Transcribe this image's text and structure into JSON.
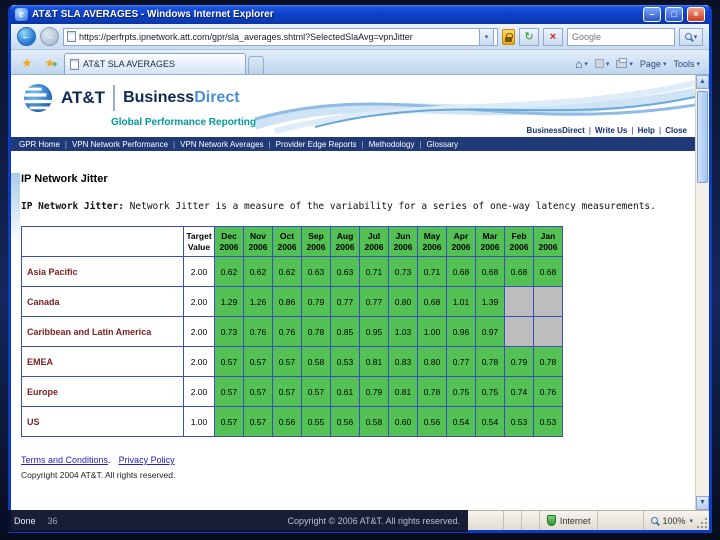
{
  "slide": {
    "page_number": "36",
    "footer_copyright": "Copyright © 2006 AT&T. All rights reserved."
  },
  "browser": {
    "title": "AT&T SLA AVERAGES - Windows Internet Explorer",
    "url": "https://perfrpts.ipnetwork.att.com/gpr/sla_averages.shtml?SelectedSlaAvg=vpnJitter",
    "search_placeholder": "Google",
    "tab": "AT&T SLA AVERAGES",
    "page_menu": "Page",
    "tools_menu": "Tools",
    "status": "Done",
    "zone": "Internet",
    "zoom": "100%"
  },
  "page": {
    "brand_att": "AT&T",
    "brand_business": "Business",
    "brand_direct": "Direct",
    "brand_subtitle": "Global Performance Reporting",
    "top_links": [
      "BusinessDirect",
      "Write Us",
      "Help",
      "Close"
    ],
    "nav_items": [
      "GPR Home",
      "VPN Network Performance",
      "VPN Network Averages",
      "Provider Edge Reports",
      "Methodology",
      "Glossary"
    ],
    "heading": "IP Network Jitter",
    "description_label": "IP Network Jitter:",
    "description_text": " Network Jitter is a measure of the variability for a series of one-way latency measurements.",
    "footer_links": [
      "Terms and Conditions",
      "Privacy Policy"
    ],
    "page_copyright": "Copyright 2004 AT&T. All rights reserved."
  },
  "table": {
    "target_header": "Target Value",
    "months": [
      "Dec 2006",
      "Nov 2006",
      "Oct 2006",
      "Sep 2006",
      "Aug 2006",
      "Jul 2006",
      "Jun 2006",
      "May 2006",
      "Apr 2006",
      "Mar 2006",
      "Feb 2006",
      "Jan 2006"
    ],
    "rows": [
      {
        "region": "Asia Pacific",
        "target": "2.00",
        "values": [
          "0.62",
          "0.62",
          "0.62",
          "0.63",
          "0.63",
          "0.71",
          "0.73",
          "0.71",
          "0.68",
          "0.68",
          "0.68",
          "0.68"
        ]
      },
      {
        "region": "Canada",
        "target": "2.00",
        "values": [
          "1.29",
          "1.26",
          "0.86",
          "0.79",
          "0.77",
          "0.77",
          "0.80",
          "0.68",
          "1.01",
          "1.39",
          null,
          null
        ]
      },
      {
        "region": "Caribbean and Latin America",
        "target": "2.00",
        "values": [
          "0.73",
          "0.76",
          "0.76",
          "0.78",
          "0.85",
          "0.95",
          "1.03",
          "1.00",
          "0.96",
          "0.97",
          null,
          null
        ]
      },
      {
        "region": "EMEA",
        "target": "2.00",
        "values": [
          "0.57",
          "0.57",
          "0.57",
          "0.58",
          "0.53",
          "0.81",
          "0.83",
          "0.80",
          "0.77",
          "0.78",
          "0.79",
          "0.78"
        ]
      },
      {
        "region": "Europe",
        "target": "2.00",
        "values": [
          "0.57",
          "0.57",
          "0.57",
          "0.57",
          "0.61",
          "0.79",
          "0.81",
          "0.78",
          "0.75",
          "0.75",
          "0.74",
          "0.76"
        ]
      },
      {
        "region": "US",
        "target": "1.00",
        "values": [
          "0.57",
          "0.57",
          "0.56",
          "0.55",
          "0.56",
          "0.58",
          "0.60",
          "0.56",
          "0.54",
          "0.54",
          "0.53",
          "0.53"
        ]
      }
    ]
  },
  "colors": {
    "cell_green": "#54c154",
    "cell_gray": "#bdbdbd",
    "table_border": "#3a4ec0",
    "nav_bg": "#203a78",
    "teal": "#009b9b",
    "link_blue": "#2020cc",
    "region_label": "#7a2222",
    "titlebar_blue": "#0e41c8"
  }
}
